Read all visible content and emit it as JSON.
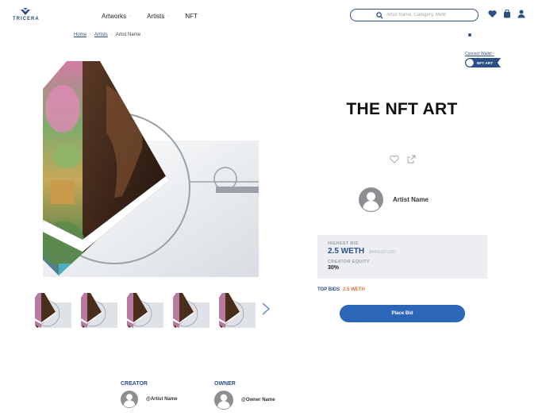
{
  "brand": {
    "logo_text": "TRICERA",
    "accent": "#2c4f86",
    "button_color": "#2c66b8",
    "highlight": "#e06f36"
  },
  "nav": {
    "items": [
      {
        "label": "Artworks"
      },
      {
        "label": "Artists"
      },
      {
        "label": "NFT"
      }
    ]
  },
  "search": {
    "placeholder": "Artist Name, Category, Motif"
  },
  "header_icons": [
    "heart-icon",
    "shopping-bag-icon",
    "user-icon"
  ],
  "breadcrumb": {
    "home": "Home",
    "artists": "Artists",
    "current": "Artist Name"
  },
  "wallet": {
    "connect_label": "Connect Wallet",
    "toggle_label": "NFT ART"
  },
  "artwork": {
    "title": "THE NFT ART",
    "thumbnail_count": 5
  },
  "artist": {
    "name": "Artist Name"
  },
  "bid": {
    "highest_label": "HIGHEST BID",
    "highest_value": "2.5 WETH",
    "highest_usd": "$4400.00 USD",
    "equity_label": "CREATOR EQUITY",
    "equity_value": "30%"
  },
  "top_bids": {
    "label": "TOP BIDS",
    "value": "2.5 WETH"
  },
  "place_bid_label": "Place Bid",
  "creator": {
    "heading": "CREATOR",
    "name": "@Artist Name"
  },
  "owner": {
    "heading": "OWNER",
    "name": "@Owner Name"
  }
}
